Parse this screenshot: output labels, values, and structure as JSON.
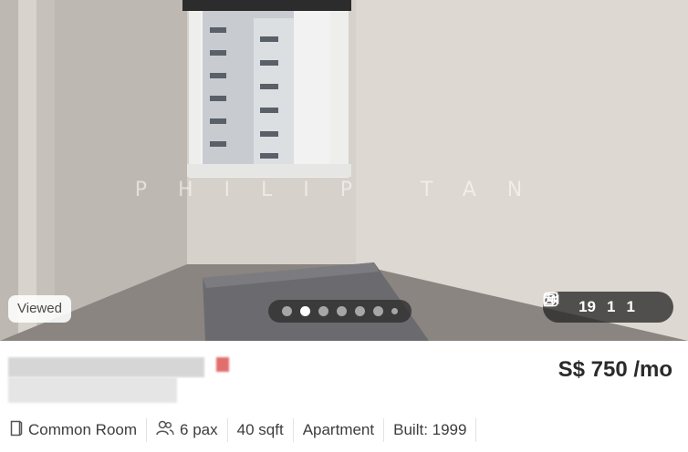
{
  "listing": {
    "photo": {
      "watermark": "PHILIP TAN",
      "viewed_badge": "Viewed",
      "carousel": {
        "dot_count": 7,
        "active_index": 1
      },
      "media_counts": {
        "photos": "19",
        "floorplans": "1",
        "videos": "1"
      }
    },
    "price": "S$ 750 /mo",
    "details": {
      "room_type": "Common Room",
      "occupancy": "6 pax",
      "size": "40 sqft",
      "property_type": "Apartment",
      "built": "Built: 1999"
    },
    "colors": {
      "accent_pixel": "#e26d6d",
      "overlay_dark": "#282828"
    },
    "icons": [
      "door-icon",
      "people-icon",
      "photo-icon",
      "floorplan-icon",
      "video-icon"
    ]
  }
}
